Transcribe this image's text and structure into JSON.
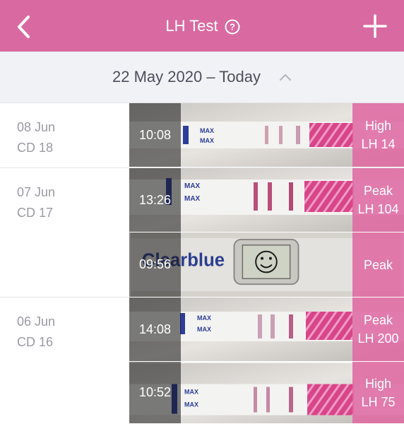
{
  "header": {
    "title": "LH Test",
    "accent": "#d86aa1"
  },
  "date_range": {
    "label": "22 May 2020 – Today"
  },
  "days": [
    {
      "date": "08 Jun",
      "cycle_day": "CD 18",
      "entries": [
        {
          "time": "10:08",
          "result": "High",
          "lh": "LH 14",
          "kind": "strip"
        }
      ]
    },
    {
      "date": "07 Jun",
      "cycle_day": "CD 17",
      "entries": [
        {
          "time": "13:26",
          "result": "Peak",
          "lh": "LH 104",
          "kind": "strip"
        },
        {
          "time": "09:56",
          "result": "Peak",
          "lh": "",
          "kind": "digital",
          "brand": "Clearblue"
        }
      ]
    },
    {
      "date": "06 Jun",
      "cycle_day": "CD 16",
      "entries": [
        {
          "time": "14:08",
          "result": "Peak",
          "lh": "LH 200",
          "kind": "strip"
        },
        {
          "time": "10:52",
          "result": "High",
          "lh": "LH 75",
          "kind": "strip"
        }
      ]
    }
  ],
  "strip_text": {
    "max": "MAX"
  }
}
